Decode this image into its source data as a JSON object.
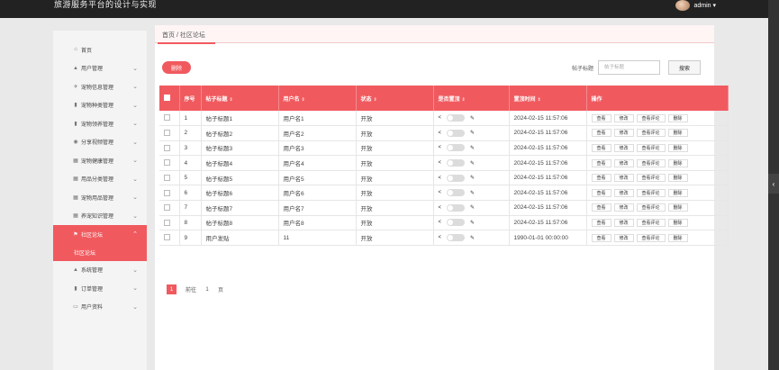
{
  "header": {
    "app_title": "旅游服务平台的设计与实现",
    "user": "admin ▾"
  },
  "sidebar": {
    "items": [
      {
        "label": "首页",
        "icon": "⌂",
        "chevron": ""
      },
      {
        "label": "用户管理",
        "icon": "▲",
        "chevron": "⌄"
      },
      {
        "label": "宠物信息管理",
        "icon": "✈",
        "chevron": "⌄"
      },
      {
        "label": "宠物种类管理",
        "icon": "▮",
        "chevron": "⌄"
      },
      {
        "label": "宠物领养管理",
        "icon": "▮",
        "chevron": "⌄"
      },
      {
        "label": "分享视频管理",
        "icon": "◉",
        "chevron": "⌄"
      },
      {
        "label": "宠物健康管理",
        "icon": "▦",
        "chevron": "⌄"
      },
      {
        "label": "用品分类管理",
        "icon": "▦",
        "chevron": "⌄"
      },
      {
        "label": "宠物用品管理",
        "icon": "▦",
        "chevron": "⌄"
      },
      {
        "label": "养宠知识管理",
        "icon": "▦",
        "chevron": "⌄"
      }
    ],
    "active": {
      "label": "社区论坛",
      "icon": "⚑",
      "chevron": "⌃"
    },
    "sub_item": "社区论坛",
    "after": [
      {
        "label": "系统管理",
        "icon": "▲",
        "chevron": "⌄"
      },
      {
        "label": "订单管理",
        "icon": "▮",
        "chevron": "⌄"
      },
      {
        "label": "用户资料",
        "icon": "▭",
        "chevron": "⌄"
      }
    ]
  },
  "breadcrumb": "首页 / 社区论坛",
  "toolbar": {
    "delete_label": "删除",
    "search_label": "帖子标题",
    "search_placeholder": "帖子标题",
    "search_button": "搜索"
  },
  "table": {
    "headers": [
      "序号",
      "帖子标题",
      "用户名",
      "状态",
      "是否置顶",
      "置顶时间",
      "操作"
    ],
    "sort_mark": "⇕",
    "actions": [
      "查看",
      "修改",
      "查看评论",
      "删除"
    ],
    "rows": [
      {
        "no": "1",
        "title": "帖子标题1",
        "user": "用户名1",
        "status": "开放",
        "time": "2024-02-15 11:57:06"
      },
      {
        "no": "2",
        "title": "帖子标题2",
        "user": "用户名2",
        "status": "开放",
        "time": "2024-02-15 11:57:06"
      },
      {
        "no": "3",
        "title": "帖子标题3",
        "user": "用户名3",
        "status": "开放",
        "time": "2024-02-15 11:57:06"
      },
      {
        "no": "4",
        "title": "帖子标题4",
        "user": "用户名4",
        "status": "开放",
        "time": "2024-02-15 11:57:06"
      },
      {
        "no": "5",
        "title": "帖子标题5",
        "user": "用户名5",
        "status": "开放",
        "time": "2024-02-15 11:57:06"
      },
      {
        "no": "6",
        "title": "帖子标题6",
        "user": "用户名6",
        "status": "开放",
        "time": "2024-02-15 11:57:06"
      },
      {
        "no": "7",
        "title": "帖子标题7",
        "user": "用户名7",
        "status": "开放",
        "time": "2024-02-15 11:57:06"
      },
      {
        "no": "8",
        "title": "帖子标题8",
        "user": "用户名8",
        "status": "开放",
        "time": "2024-02-15 11:57:06"
      },
      {
        "no": "9",
        "title": "用户发贴",
        "user": "11",
        "status": "开放",
        "time": "1990-01-01 00:00:00"
      }
    ]
  },
  "pagination": {
    "current": "1",
    "goto_label": "前往",
    "page_value": "1",
    "page_suffix": "页"
  },
  "icons": {
    "share": "share-icon",
    "edit": "edit-icon",
    "sort": "sort-icon"
  },
  "colors": {
    "accent": "#f05a5f",
    "header_bg": "#222222"
  }
}
